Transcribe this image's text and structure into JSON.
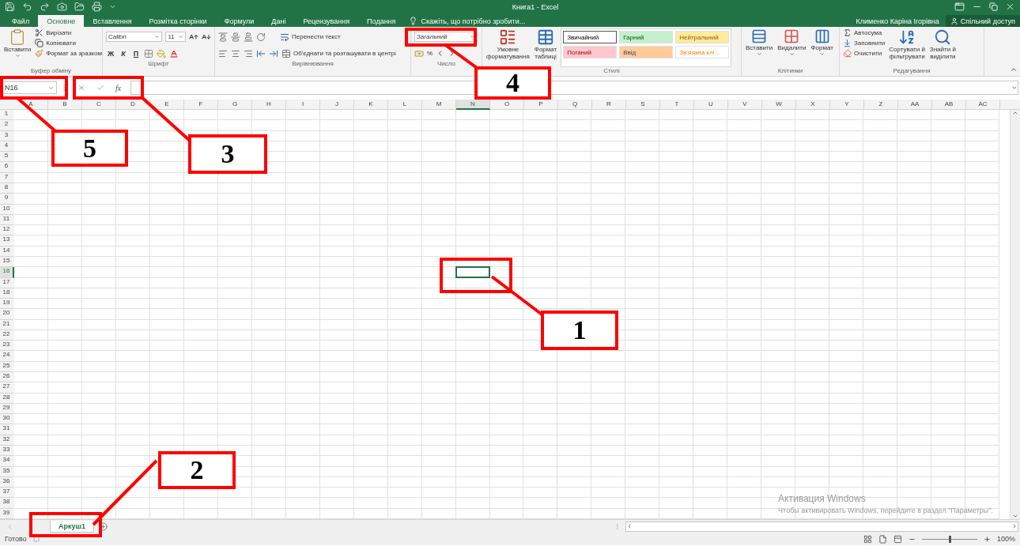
{
  "window": {
    "title": "Книга1 - Excel",
    "user": "Клименко Каріна Ігорівна",
    "share": "Спільний доступ"
  },
  "tabs": [
    {
      "label": "Файл",
      "selected": false
    },
    {
      "label": "Основне",
      "selected": true
    },
    {
      "label": "Вставлення",
      "selected": false
    },
    {
      "label": "Розмітка сторінки",
      "selected": false
    },
    {
      "label": "Формули",
      "selected": false
    },
    {
      "label": "Дані",
      "selected": false
    },
    {
      "label": "Рецензування",
      "selected": false
    },
    {
      "label": "Подання",
      "selected": false
    }
  ],
  "tell_me": "Скажіть, що потрібно зробити...",
  "ribbon": {
    "clipboard": {
      "title": "Буфер обміну",
      "paste": "Вставити",
      "cut": "Вирізати",
      "copy": "Копіювати",
      "painter": "Формат за зразком"
    },
    "font": {
      "title": "Шрифт",
      "name": "Calibri",
      "size": "11",
      "bold": "Ж",
      "italic": "К",
      "underline": "П"
    },
    "alignment": {
      "title": "Вирівнювання",
      "wrap": "Перенести текст",
      "merge": "Об'єднати та розташувати в центрі"
    },
    "number": {
      "title": "Число",
      "format": "Загальний",
      "percent": "%"
    },
    "styles": {
      "title": "Стилі",
      "conditional": [
        "Умовне",
        "форматування"
      ],
      "table": [
        "Формат",
        "таблиці"
      ],
      "cells": [
        {
          "label": "Звичайний",
          "color": "#ffffff",
          "selected": true
        },
        {
          "label": "Гарний",
          "color": "#c6efce",
          "selected": false
        },
        {
          "label": "Нейтральний",
          "color": "#ffeb9c",
          "selected": false
        },
        {
          "label": "Поганий",
          "color": "#ffc7ce",
          "selected": false
        },
        {
          "label": "Ввід",
          "color": "#ffcc99",
          "selected": false
        },
        {
          "label": "Зв'язана клі...",
          "color": "#ffffff",
          "selected": false
        }
      ]
    },
    "cells": {
      "title": "Клітинки",
      "insert": "Вставити",
      "delete": "Видалити",
      "format": "Формат"
    },
    "editing": {
      "title": "Редагування",
      "autosum": "Автосума",
      "fill": "Заповнити",
      "clear": "Очистити",
      "sort": [
        "Сортувати й",
        "фільтрувати"
      ],
      "find": [
        "Знайти й",
        "виділити"
      ]
    }
  },
  "formula_bar": {
    "name_box": "N16",
    "fx": "fx"
  },
  "grid": {
    "columns": [
      {
        "label": "A",
        "selected": false
      },
      {
        "label": "B",
        "selected": false
      },
      {
        "label": "C",
        "selected": false
      },
      {
        "label": "D",
        "selected": false
      },
      {
        "label": "E",
        "selected": false
      },
      {
        "label": "F",
        "selected": false
      },
      {
        "label": "G",
        "selected": false
      },
      {
        "label": "H",
        "selected": false
      },
      {
        "label": "I",
        "selected": false
      },
      {
        "label": "J",
        "selected": false
      },
      {
        "label": "K",
        "selected": false
      },
      {
        "label": "L",
        "selected": false
      },
      {
        "label": "M",
        "selected": false
      },
      {
        "label": "N",
        "selected": true
      },
      {
        "label": "O",
        "selected": false
      },
      {
        "label": "P",
        "selected": false
      },
      {
        "label": "Q",
        "selected": false
      },
      {
        "label": "R",
        "selected": false
      },
      {
        "label": "S",
        "selected": false
      },
      {
        "label": "T",
        "selected": false
      },
      {
        "label": "U",
        "selected": false
      },
      {
        "label": "V",
        "selected": false
      },
      {
        "label": "W",
        "selected": false
      },
      {
        "label": "X",
        "selected": false
      },
      {
        "label": "Y",
        "selected": false
      },
      {
        "label": "Z",
        "selected": false
      },
      {
        "label": "AA",
        "selected": false
      },
      {
        "label": "AB",
        "selected": false
      },
      {
        "label": "AC",
        "selected": false
      }
    ],
    "rows": [
      {
        "label": "1",
        "selected": false
      },
      {
        "label": "2",
        "selected": false
      },
      {
        "label": "3",
        "selected": false
      },
      {
        "label": "4",
        "selected": false
      },
      {
        "label": "5",
        "selected": false
      },
      {
        "label": "6",
        "selected": false
      },
      {
        "label": "7",
        "selected": false
      },
      {
        "label": "8",
        "selected": false
      },
      {
        "label": "9",
        "selected": false
      },
      {
        "label": "10",
        "selected": false
      },
      {
        "label": "11",
        "selected": false
      },
      {
        "label": "12",
        "selected": false
      },
      {
        "label": "13",
        "selected": false
      },
      {
        "label": "14",
        "selected": false
      },
      {
        "label": "15",
        "selected": false
      },
      {
        "label": "16",
        "selected": true
      },
      {
        "label": "17",
        "selected": false
      },
      {
        "label": "18",
        "selected": false
      },
      {
        "label": "19",
        "selected": false
      },
      {
        "label": "20",
        "selected": false
      },
      {
        "label": "21",
        "selected": false
      },
      {
        "label": "22",
        "selected": false
      },
      {
        "label": "23",
        "selected": false
      },
      {
        "label": "24",
        "selected": false
      },
      {
        "label": "25",
        "selected": false
      },
      {
        "label": "26",
        "selected": false
      },
      {
        "label": "27",
        "selected": false
      },
      {
        "label": "28",
        "selected": false
      },
      {
        "label": "29",
        "selected": false
      },
      {
        "label": "30",
        "selected": false
      },
      {
        "label": "31",
        "selected": false
      },
      {
        "label": "32",
        "selected": false
      },
      {
        "label": "33",
        "selected": false
      },
      {
        "label": "34",
        "selected": false
      },
      {
        "label": "35",
        "selected": false
      },
      {
        "label": "36",
        "selected": false
      },
      {
        "label": "37",
        "selected": false
      },
      {
        "label": "38",
        "selected": false
      },
      {
        "label": "39",
        "selected": false
      }
    ]
  },
  "activation": {
    "title": "Активация Windows",
    "text": "Чтобы активировать Windows, перейдите в раздел \"Параметры\"."
  },
  "sheets": [
    {
      "label": "Аркуш1",
      "selected": true
    }
  ],
  "status": {
    "text": "Готово",
    "zoom": "100%",
    "level": 0.5
  },
  "annotations": [
    {
      "label": "1"
    },
    {
      "label": "2"
    },
    {
      "label": "3"
    },
    {
      "label": "4"
    },
    {
      "label": "5"
    }
  ]
}
